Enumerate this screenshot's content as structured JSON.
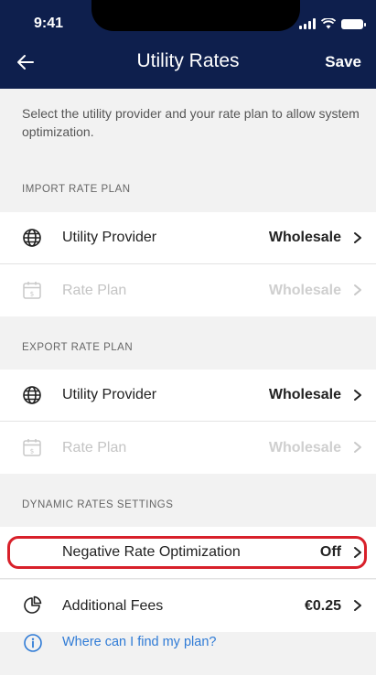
{
  "status_bar": {
    "time": "9:41"
  },
  "nav": {
    "title": "Utility Rates",
    "save_label": "Save",
    "back_icon": "arrow-left-icon"
  },
  "description": "Select the utility provider and your rate plan to allow system optimization.",
  "import_section": {
    "title": "IMPORT RATE PLAN",
    "rows": [
      {
        "label": "Utility Provider",
        "value": "Wholesale",
        "icon": "globe-icon",
        "enabled": true
      },
      {
        "label": "Rate Plan",
        "value": "Wholesale",
        "icon": "calendar-dollar-icon",
        "enabled": false
      }
    ]
  },
  "export_section": {
    "title": "EXPORT RATE PLAN",
    "rows": [
      {
        "label": "Utility Provider",
        "value": "Wholesale",
        "icon": "globe-icon",
        "enabled": true
      },
      {
        "label": "Rate Plan",
        "value": "Wholesale",
        "icon": "calendar-dollar-icon",
        "enabled": false
      }
    ]
  },
  "dynamic_section": {
    "title": "DYNAMIC RATES SETTINGS",
    "rows": [
      {
        "label": "Negative Rate Optimization",
        "value": "Off",
        "highlighted": true
      },
      {
        "label": "Additional Fees",
        "value": "€0.25",
        "icon": "pie-chart-icon"
      }
    ]
  },
  "help": {
    "text": "Where can I find my plan?",
    "icon": "info-icon"
  },
  "colors": {
    "header_bg": "#0e1f4d",
    "highlight": "#d8202a",
    "link": "#2f7bd6"
  }
}
